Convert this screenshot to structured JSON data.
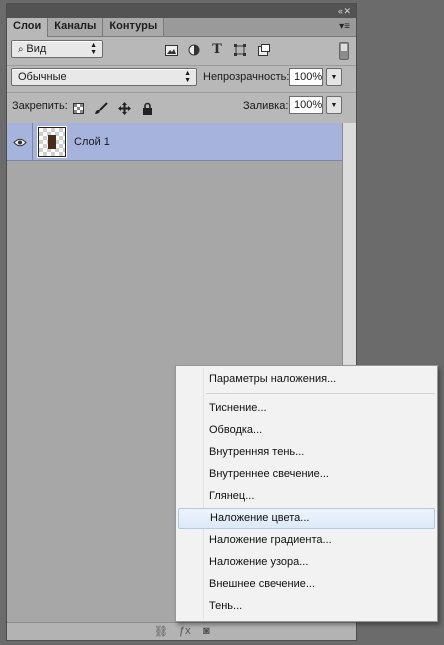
{
  "panel": {
    "collapse_glyph": "‹‹ ✕",
    "tabs": [
      "Слои",
      "Каналы",
      "Контуры"
    ],
    "menu_glyph": "▾≡",
    "filter": {
      "kind_label": "Вид",
      "icons": [
        "image-filter-icon",
        "adjustment-filter-icon",
        "type-filter-icon",
        "shape-filter-icon",
        "smart-object-filter-icon"
      ]
    },
    "blend_mode": "Обычные",
    "opacity_label": "Непрозрачность:",
    "opacity_value": "100%",
    "lock_label": "Закрепить:",
    "fill_label": "Заливка:",
    "fill_value": "100%",
    "layers": [
      {
        "name": "Слой 1",
        "visible": true,
        "selected": true
      }
    ],
    "selection_color": "#a6b3dc"
  },
  "context_menu": {
    "items": [
      "Параметры наложения...",
      "Тиснение...",
      "Обводка...",
      "Внутренняя тень...",
      "Внутреннее свечение...",
      "Глянец...",
      "Наложение цвета...",
      "Наложение градиента...",
      "Наложение узора...",
      "Внешнее свечение...",
      "Тень..."
    ],
    "highlighted": "Наложение цвета..."
  }
}
